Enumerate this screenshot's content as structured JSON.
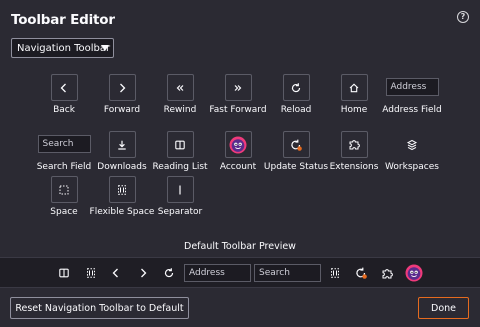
{
  "title": "Toolbar Editor",
  "help_label": "?",
  "toolbar_select": {
    "selected": "Navigation Toolbar"
  },
  "items": {
    "back": "Back",
    "forward": "Forward",
    "rewind": "Rewind",
    "fast_forward": "Fast Forward",
    "reload": "Reload",
    "home": "Home",
    "address_field": "Address Field",
    "address_placeholder": "Address",
    "search_field": "Search Field",
    "search_placeholder": "Search",
    "downloads": "Downloads",
    "reading_list": "Reading List",
    "account": "Account",
    "update_status": "Update Status",
    "extensions": "Extensions",
    "workspaces": "Workspaces",
    "space": "Space",
    "flexible_space": "Flexible Space",
    "separator": "Separator"
  },
  "preview": {
    "title": "Default Toolbar Preview",
    "address_placeholder": "Address",
    "search_placeholder": "Search"
  },
  "buttons": {
    "reset": "Reset Navigation Toolbar to Default",
    "done": "Done"
  },
  "colors": {
    "accent": "#e66b1f",
    "background": "#2b2a33"
  }
}
